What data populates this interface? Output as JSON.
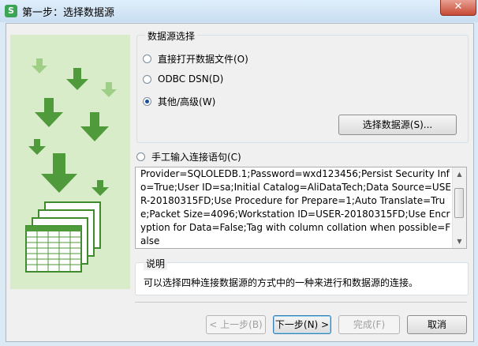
{
  "window": {
    "title": "第一步：选择数据源",
    "app_icon_letter": "S",
    "close_symbol": "✕"
  },
  "source_group": {
    "legend": "数据源选择",
    "options": [
      {
        "label": "直接打开数据文件(O)",
        "selected": false
      },
      {
        "label": "ODBC DSN(D)",
        "selected": false
      },
      {
        "label": "其他/高级(W)",
        "selected": true
      }
    ],
    "select_button": "选择数据源(S)..."
  },
  "manual": {
    "label": "手工输入连接语句(C)",
    "selected": false,
    "connection_text": "Provider=SQLOLEDB.1;Password=wxd123456;Persist Security Info=True;User ID=sa;Initial Catalog=AliDataTech;Data Source=USER-20180315FD;Use Procedure for Prepare=1;Auto Translate=True;Packet Size=4096;Workstation ID=USER-20180315FD;Use Encryption for Data=False;Tag with column collation when possible=False"
  },
  "description": {
    "legend": "说明",
    "text": "可以选择四种连接数据源的方式中的一种来进行和数据源的连接。"
  },
  "buttons": {
    "prev": "< 上一步(B)",
    "next": "下一步(N) >",
    "finish": "完成(F)",
    "cancel": "取消"
  },
  "icons": {
    "art": "green-arrows-spreadsheet-icon",
    "scroll_up": "scroll-up-icon",
    "scroll_down": "scroll-down-icon"
  },
  "colors": {
    "art_bg": "#d8ecc9",
    "arrow_dark": "#4f9a3a",
    "arrow_light": "#9fcf86",
    "titlebar": "#c9def2"
  }
}
